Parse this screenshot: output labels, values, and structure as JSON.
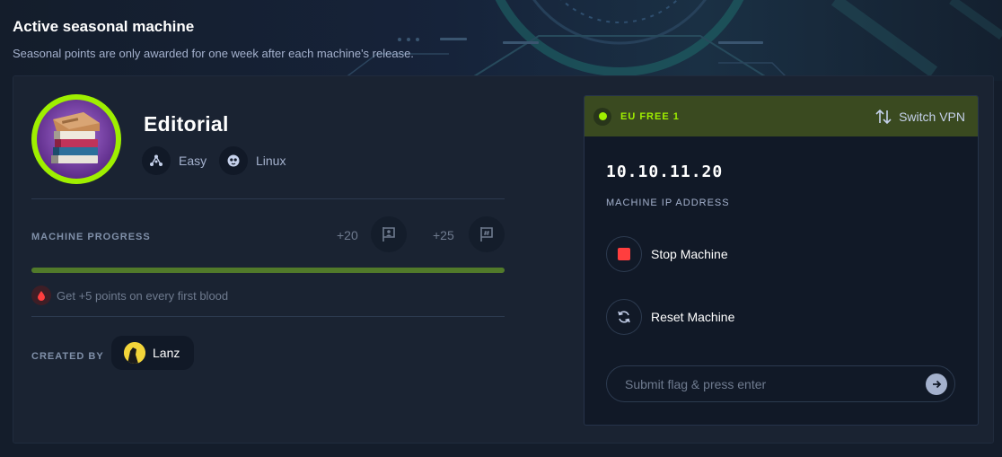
{
  "header": {
    "title": "Active seasonal machine",
    "subtitle": "Seasonal points are only awarded for one week after each machine's release."
  },
  "machine": {
    "name": "Editorial",
    "difficulty": "Easy",
    "os": "Linux",
    "progress_label": "MACHINE PROGRESS",
    "progress_fraction": 1.0,
    "user_points": "+20",
    "root_points": "+25",
    "first_blood_text": "Get +5 points on every first blood",
    "created_by_label": "CREATED BY",
    "creator": "Lanz"
  },
  "panel": {
    "vpn_name": "EU FREE 1",
    "switch_vpn_label": "Switch VPN",
    "ip": "10.10.11.20",
    "ip_label": "MACHINE IP ADDRESS",
    "stop_label": "Stop Machine",
    "reset_label": "Reset Machine",
    "flag_placeholder": "Submit flag & press enter"
  },
  "colors": {
    "accent": "#9fef00",
    "progress_fill": "#517a2a",
    "stop": "#ff3e3e",
    "background": "#141d2b",
    "card": "#1a2332"
  }
}
